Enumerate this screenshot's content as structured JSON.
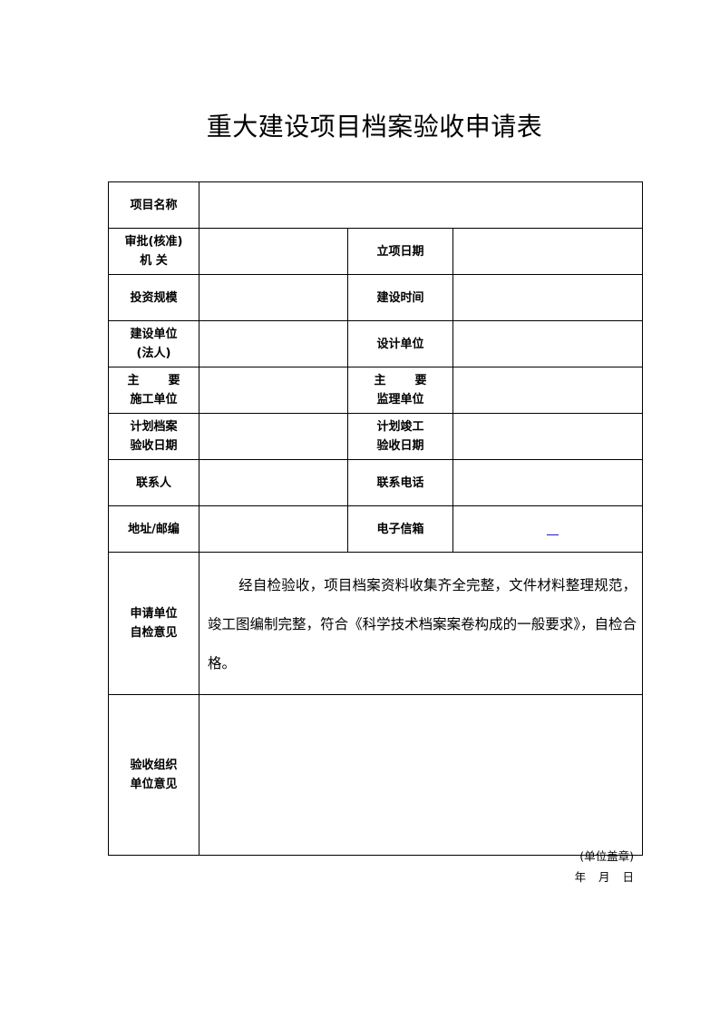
{
  "title": "重大建设项目档案验收申请表",
  "rows": {
    "project_name": {
      "label": "项目名称",
      "value": ""
    },
    "approval_org": {
      "label_line1": "审批(核准)",
      "label_line2": "机 关",
      "value": ""
    },
    "establish_date": {
      "label": "立项日期",
      "value": ""
    },
    "investment_scale": {
      "label": "投资规模",
      "value": ""
    },
    "construction_time": {
      "label": "建设时间",
      "value": ""
    },
    "builder": {
      "label_line1": "建设单位",
      "label_line2": "(法人)",
      "value": ""
    },
    "designer": {
      "label": "设计单位",
      "value": ""
    },
    "main_contractor": {
      "label_line1a": "主",
      "label_line1b": "要",
      "label_line2": "施工单位",
      "value": ""
    },
    "main_supervisor": {
      "label_line1a": "主",
      "label_line1b": "要",
      "label_line2": "监理单位",
      "value": ""
    },
    "planned_archive_date": {
      "label_line1": "计划档案",
      "label_line2": "验收日期",
      "value": ""
    },
    "planned_completion_date": {
      "label_line1": "计划竣工",
      "label_line2": "验收日期",
      "value": ""
    },
    "contact_person": {
      "label": "联系人",
      "value": ""
    },
    "contact_phone": {
      "label": "联系电话",
      "value": ""
    },
    "address_zip": {
      "label": "地址/邮编",
      "value": ""
    },
    "email": {
      "label": "电子信箱",
      "value": ""
    },
    "applicant_opinion": {
      "label_line1": "申请单位",
      "label_line2": "自检意见",
      "text": "经自检验收，项目档案资料收集齐全完整，文件材料整理规范，竣工图编制完整，符合《科学技术档案案卷构成的一般要求》，自检合格。"
    },
    "acceptance_org_opinion": {
      "label_line1": "验收组织",
      "label_line2": "单位意见",
      "stamp": "(单位盖章)",
      "date": "年 月 日"
    }
  },
  "colors": {
    "border": "#000000",
    "link": "#1a1ad0"
  }
}
